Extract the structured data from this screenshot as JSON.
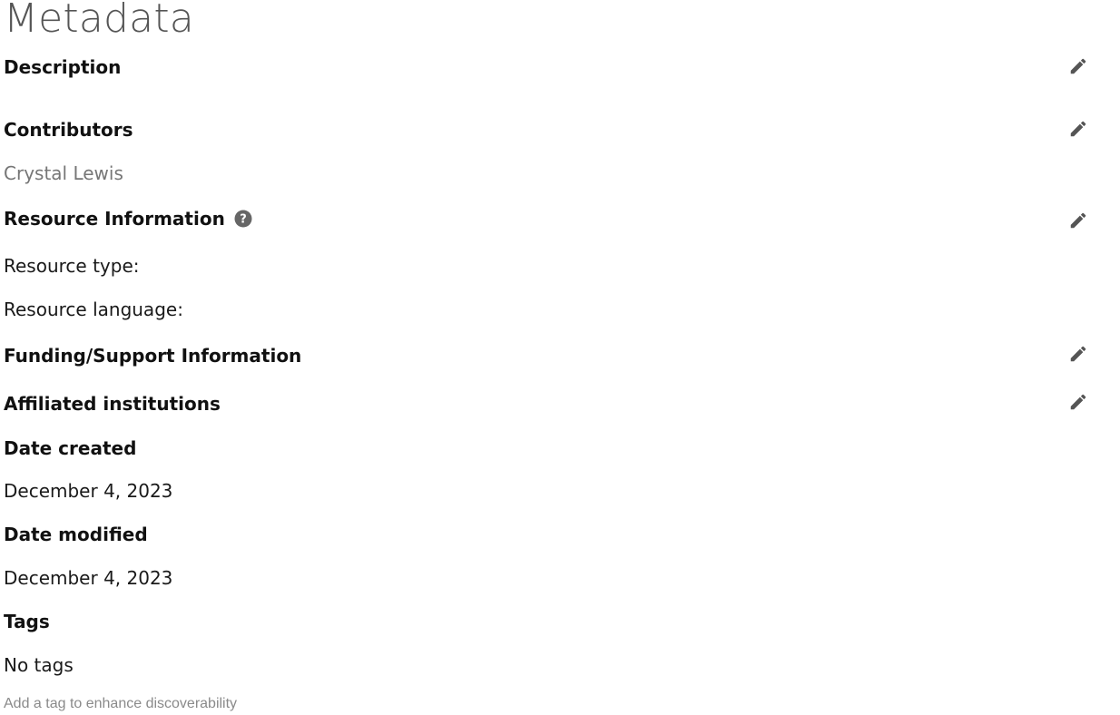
{
  "page": {
    "title": "Metadata"
  },
  "sections": {
    "description": {
      "heading": "Description"
    },
    "contributors": {
      "heading": "Contributors",
      "names": [
        "Crystal Lewis"
      ]
    },
    "resource_information": {
      "heading": "Resource Information",
      "help_icon": "question-circle-icon",
      "type_label": "Resource type:",
      "language_label": "Resource language:"
    },
    "funding": {
      "heading": "Funding/Support Information"
    },
    "affiliated_institutions": {
      "heading": "Affiliated institutions"
    },
    "date_created": {
      "heading": "Date created",
      "value": "December 4, 2023"
    },
    "date_modified": {
      "heading": "Date modified",
      "value": "December 4, 2023"
    },
    "tags": {
      "heading": "Tags",
      "value": "No tags",
      "hint": "Add a tag to enhance discoverability"
    }
  },
  "icons": {
    "edit": "pencil-icon"
  },
  "colors": {
    "heading": "#111111",
    "muted_text": "#767676",
    "hint_text": "#8a8a8a",
    "icon": "#555555"
  }
}
